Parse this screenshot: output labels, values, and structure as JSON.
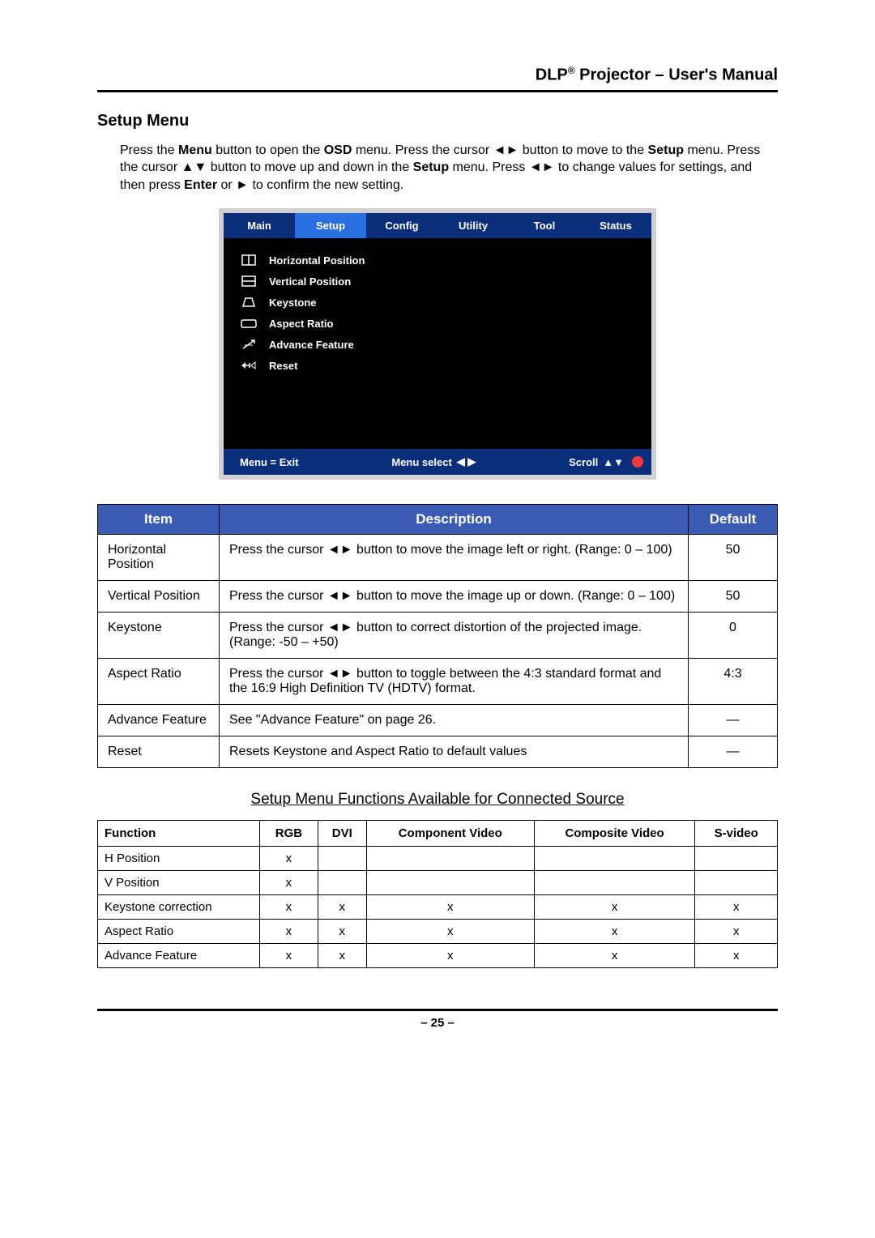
{
  "header": {
    "title_prefix": "DLP",
    "title_sup": "®",
    "title_suffix": " Projector – User's Manual"
  },
  "section_title": "Setup Menu",
  "intro": {
    "s1a": "Press the ",
    "menu": "Menu",
    "s1b": " button to open the ",
    "osd": "OSD",
    "s1c": " menu. Press the cursor ◄► button to move to the ",
    "setup1": "Setup",
    "s1d": " menu. Press the cursor ▲▼ button to move up and down in the ",
    "setup2": "Setup",
    "s1e": " menu. Press ◄► to change values for settings, and then press ",
    "enter": "Enter",
    "s1f": " or ► to confirm the new setting."
  },
  "osd": {
    "tabs": [
      "Main",
      "Setup",
      "Config",
      "Utility",
      "Tool",
      "Status"
    ],
    "active_index": 1,
    "rows": [
      {
        "icon": "hpos",
        "label": "Horizontal Position"
      },
      {
        "icon": "vpos",
        "label": "Vertical Position"
      },
      {
        "icon": "keystone",
        "label": "Keystone"
      },
      {
        "icon": "aspect",
        "label": "Aspect Ratio"
      },
      {
        "icon": "advance",
        "label": "Advance Feature"
      },
      {
        "icon": "reset",
        "label": "Reset"
      }
    ],
    "footer": {
      "exit": "Menu = Exit",
      "select": "Menu select",
      "select_sym": "◀ ▶",
      "scroll": "Scroll",
      "scroll_sym": "▲▼"
    }
  },
  "items_table": {
    "head": {
      "item": "Item",
      "desc": "Description",
      "def": "Default"
    },
    "rows": [
      {
        "item": "Horizontal Position",
        "desc": "Press the cursor ◄► button to move the image left or right. (Range: 0 – 100)",
        "def": "50"
      },
      {
        "item": "Vertical Position",
        "desc": "Press the cursor ◄► button to move the image up or down. (Range: 0 – 100)",
        "def": "50"
      },
      {
        "item": "Keystone",
        "desc": "Press the cursor ◄► button to correct distortion of the projected image.\n(Range: -50 – +50)",
        "def": "0"
      },
      {
        "item": "Aspect Ratio",
        "desc": "Press the cursor ◄► button to toggle between the 4:3 standard format and the 16:9 High Definition TV (HDTV) format.",
        "def": "4:3"
      },
      {
        "item": "Advance Feature",
        "desc": "See \"Advance Feature\" on page 26.",
        "def": "—"
      },
      {
        "item": "Reset",
        "desc": "Resets Keystone and Aspect Ratio to default values",
        "def": "—"
      }
    ]
  },
  "sub_title": "Setup Menu Functions Available for Connected Source",
  "avail_table": {
    "head": [
      "Function",
      "RGB",
      "DVI",
      "Component Video",
      "Composite Video",
      "S-video"
    ],
    "rows": [
      {
        "fn": "H Position",
        "v": [
          "x",
          "",
          "",
          "",
          ""
        ]
      },
      {
        "fn": "V Position",
        "v": [
          "x",
          "",
          "",
          "",
          ""
        ]
      },
      {
        "fn": "Keystone correction",
        "v": [
          "x",
          "x",
          "x",
          "x",
          "x"
        ]
      },
      {
        "fn": "Aspect Ratio",
        "v": [
          "x",
          "x",
          "x",
          "x",
          "x"
        ]
      },
      {
        "fn": "Advance Feature",
        "v": [
          "x",
          "x",
          "x",
          "x",
          "x"
        ]
      }
    ]
  },
  "footer": "– 25 –"
}
